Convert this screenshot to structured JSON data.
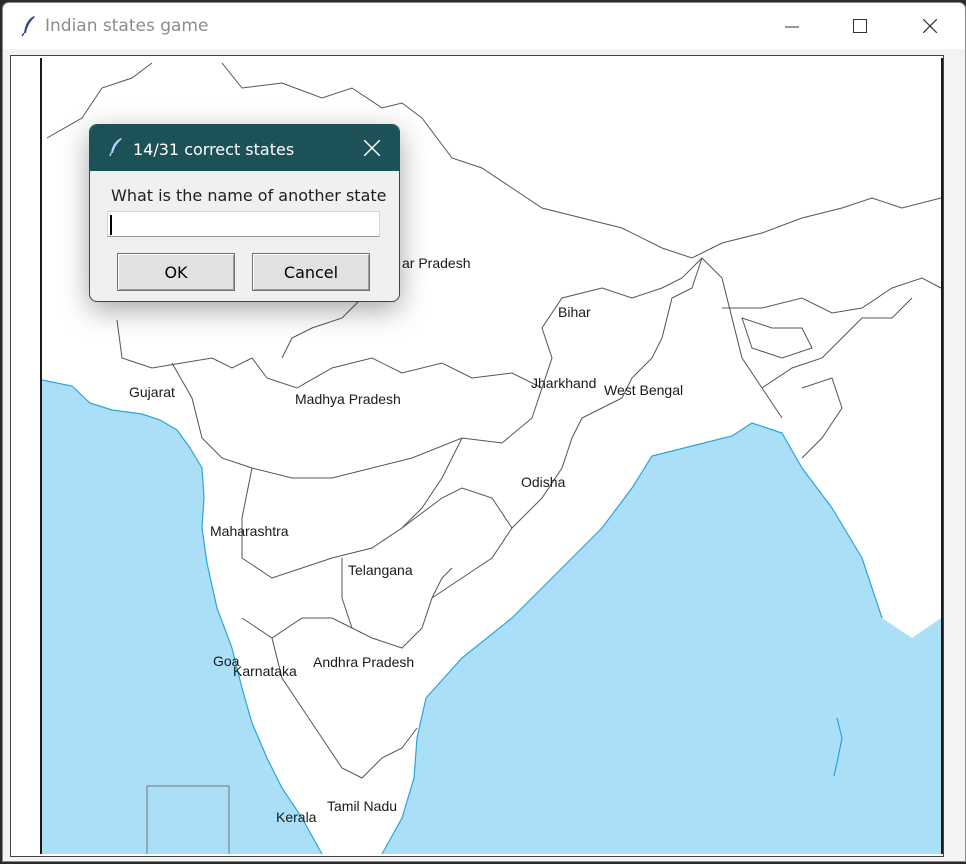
{
  "window": {
    "title": "Indian states game",
    "icon": "feather-icon",
    "controls": [
      "minimize-icon",
      "maximize-icon",
      "close-icon"
    ]
  },
  "map": {
    "sea_color": "#aadff7",
    "land_color": "#ffffff",
    "border_color": "#555555",
    "labels": [
      "Gujarat",
      "ar Pradesh",
      "Bihar",
      "Jharkhand",
      "West Bengal",
      "Madhya Pradesh",
      "Odisha",
      "Maharashtra",
      "Telangana",
      "Goa",
      "Karnataka",
      "Andhra Pradesh",
      "Tamil Nadu",
      "Kerala"
    ]
  },
  "dialog": {
    "title": "14/31 correct states",
    "prompt": "What is the name of another state",
    "input_value": "",
    "ok_label": "OK",
    "cancel_label": "Cancel",
    "title_bar_color": "#1c5257"
  }
}
